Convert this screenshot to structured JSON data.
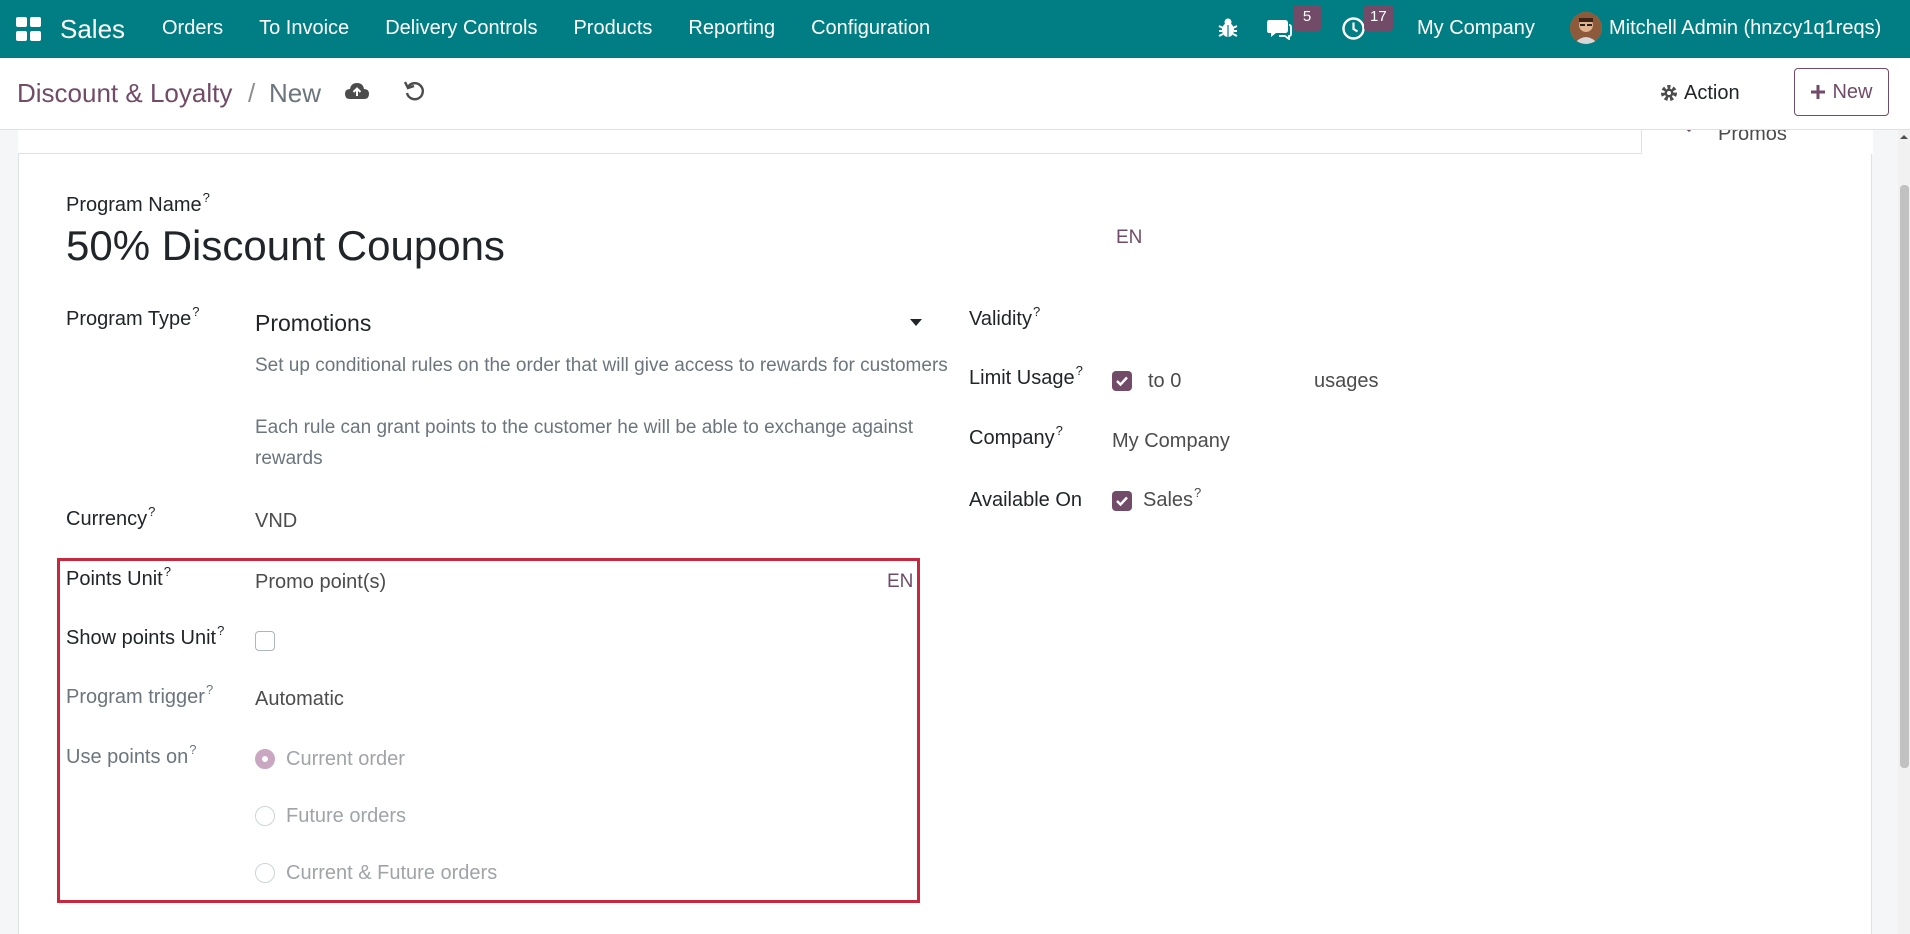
{
  "topbar": {
    "app_name": "Sales",
    "menu": [
      "Orders",
      "To Invoice",
      "Delivery Controls",
      "Products",
      "Reporting",
      "Configuration"
    ],
    "chat_count": "5",
    "activity_count": "17",
    "company": "My Company",
    "user": "Mitchell Admin (hnzcy1q1reqs)"
  },
  "control": {
    "breadcrumb_parent": "Discount & Loyalty",
    "breadcrumb_sep": "/",
    "breadcrumb_current": "New",
    "action_label": "Action",
    "new_label": "New"
  },
  "smart": {
    "promos_label": "Promos"
  },
  "form": {
    "program_name_label": "Program Name",
    "program_name": "50% Discount Coupons",
    "lang": "EN",
    "program_type_label": "Program Type",
    "program_type": "Promotions",
    "program_type_help_1": "Set up conditional rules on the order that will give access to rewards for customers",
    "program_type_help_2": "Each rule can grant points to the customer he will be able to exchange against rewards",
    "currency_label": "Currency",
    "currency": "VND",
    "points_unit_label": "Points Unit",
    "points_unit": "Promo point(s)",
    "show_points_unit_label": "Show points Unit",
    "program_trigger_label": "Program trigger",
    "program_trigger": "Automatic",
    "use_points_on_label": "Use points on",
    "use_points_options": [
      "Current order",
      "Future orders",
      "Current & Future orders"
    ],
    "validity_label": "Validity",
    "limit_usage_label": "Limit Usage",
    "limit_to": "to 0",
    "usages": "usages",
    "company_label": "Company",
    "company": "My Company",
    "available_on_label": "Available On",
    "available_sales": "Sales",
    "help_mark": "?"
  },
  "colors": {
    "topbar": "#017e84",
    "brand_purple": "#714b67",
    "highlight": "#c8273e"
  }
}
